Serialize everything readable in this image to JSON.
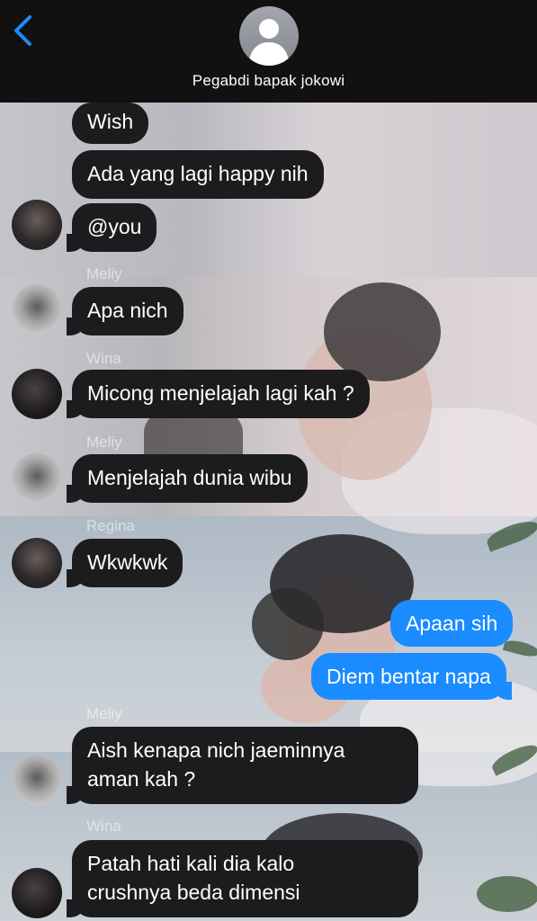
{
  "header": {
    "contact_name": "Pegabdi bapak jokowi",
    "back_icon": "chevron-left-icon",
    "avatar_icon": "person-silhouette-icon"
  },
  "colors": {
    "header_bg": "#111112",
    "incoming_bubble": "#1c1c1e",
    "outgoing_bubble": "#1a8cff",
    "back_icon": "#1a8cff"
  },
  "messages": [
    {
      "text": "Wish"
    },
    {
      "text": "Ada yang lagi happy nih"
    },
    {
      "text": "@you"
    },
    {
      "sender": "Meliy",
      "text": "Apa nich"
    },
    {
      "sender": "Wina",
      "text": "Micong menjelajah lagi kah ?"
    },
    {
      "sender": "Meliy",
      "text": "Menjelajah dunia wibu"
    },
    {
      "sender": "Regina",
      "text": "Wkwkwk"
    },
    {
      "text": "Apaan sih"
    },
    {
      "text": "Diem bentar napa"
    },
    {
      "sender": "Meliy",
      "text_line1": "Aish kenapa nich jaeminnya",
      "text_line2": "aman kah ?"
    },
    {
      "sender": "Wina",
      "text_line1": "Patah hati kali dia kalo",
      "text_line2": "crushnya beda dimensi"
    }
  ]
}
